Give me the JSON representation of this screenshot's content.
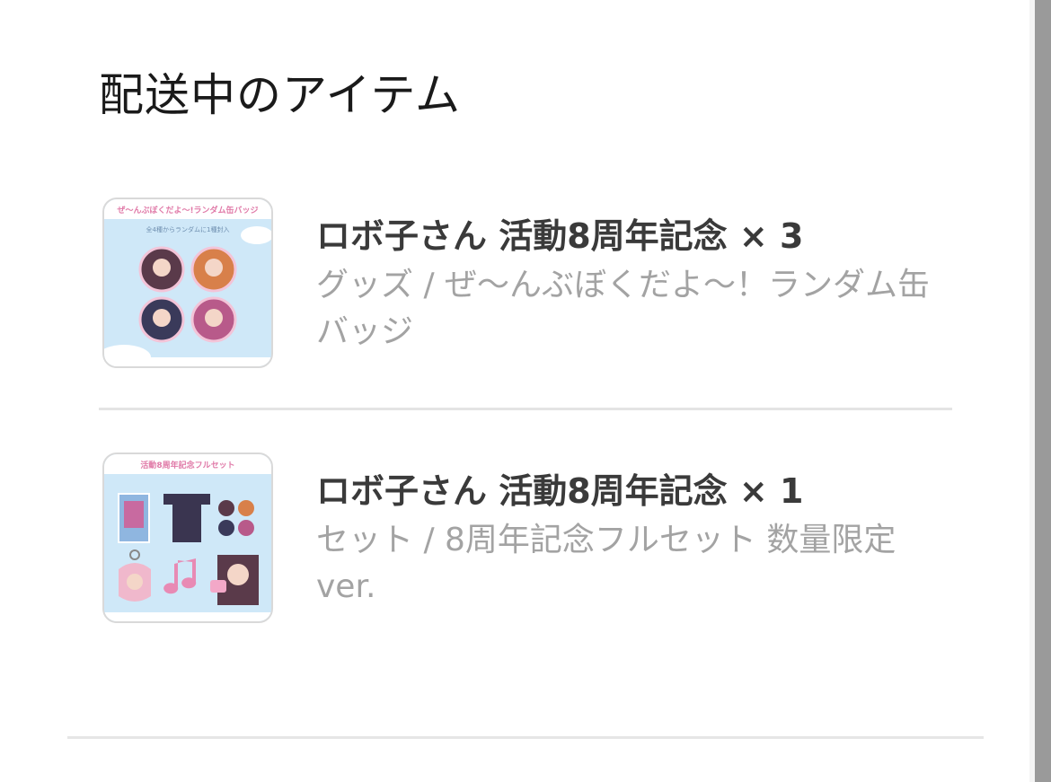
{
  "section": {
    "title": "配送中のアイテム"
  },
  "items": [
    {
      "title": "ロボ子さん 活動8周年記念 × 3",
      "subtitle": "グッズ / ぜ〜んぶぼくだよ〜！ランダム缶バッジ",
      "thumbnail_caption": "ぜ〜んぶぼくだよ〜!ランダム缶バッジ",
      "thumbnail_note": "全4種からランダムに1種封入"
    },
    {
      "title": "ロボ子さん 活動8周年記念 × 1",
      "subtitle": "セット / 8周年記念フルセット 数量限定ver.",
      "thumbnail_caption": "活動8周年記念フルセット"
    }
  ],
  "colors": {
    "thumb_bg": "#cfe8f8",
    "title_text": "#3a3a3a",
    "subtitle_text": "#a3a3a3",
    "accent_pink": "#e88ab4"
  }
}
